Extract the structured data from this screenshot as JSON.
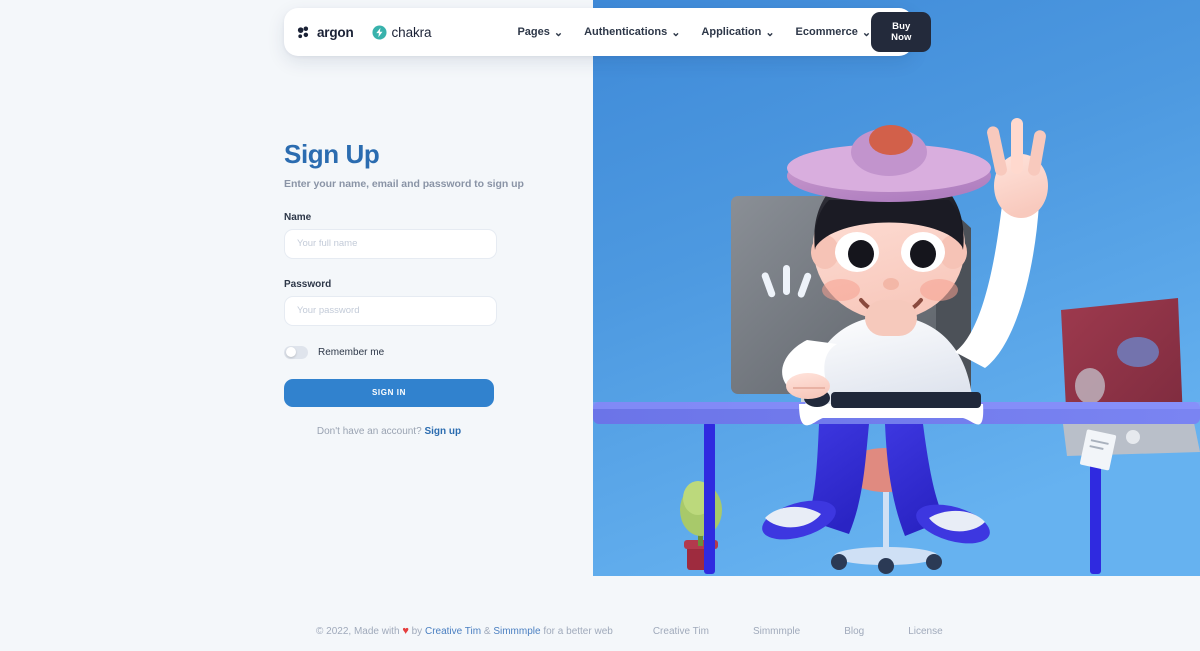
{
  "navbar": {
    "brand": {
      "name": "argon",
      "icon": "argon-logo-icon"
    },
    "secondary_brand": {
      "name": "chakra",
      "icon": "chakra-bolt-icon"
    },
    "links": [
      {
        "label": "Pages",
        "caret": "⌄"
      },
      {
        "label": "Authentications",
        "caret": "⌄"
      },
      {
        "label": "Application",
        "caret": "⌄"
      },
      {
        "label": "Ecommerce",
        "caret": "⌄"
      }
    ],
    "cta": "Buy Now"
  },
  "form": {
    "title": "Sign Up",
    "subtitle": "Enter your name, email and password to sign up",
    "fields": [
      {
        "label": "Name",
        "value": "",
        "placeholder": "Your full name",
        "type": "text"
      },
      {
        "label": "Password",
        "value": "",
        "placeholder": "Your password",
        "type": "password"
      }
    ],
    "remember": {
      "label": "Remember me",
      "checked": false
    },
    "submit": "SIGN IN",
    "footer_prompt": "Don't have an account?",
    "footer_link": "Sign up"
  },
  "hero": {
    "alt": "3d-illustration-person-at-desk",
    "background_start": "#3f8ad8",
    "background_end": "#63b0ef"
  },
  "footer": {
    "copyright_prefix": "© 2022, Made with",
    "heart": "♥",
    "by": "by",
    "link1": "Creative Tim",
    "amp": "&",
    "link2": "Simmmple",
    "suffix": "for a better web",
    "links": [
      "Creative Tim",
      "Simmmple",
      "Blog",
      "License"
    ]
  },
  "colors": {
    "accent_blue": "#3182ce",
    "title_blue": "#2b6cb0",
    "dark_button": "#232a3b",
    "page_bg": "#f4f7fa",
    "heart_red": "#e53e3e"
  }
}
